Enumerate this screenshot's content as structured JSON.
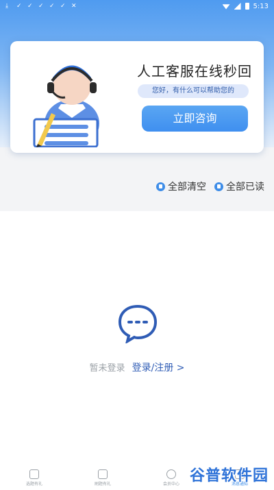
{
  "status_bar": {
    "time": "5:13"
  },
  "service_card": {
    "title": "人工客服在线秒回",
    "subtitle": "您好，有什么可以帮助您的",
    "consult_button": "立即咨询"
  },
  "actions": {
    "clear_all": "全部清空",
    "mark_all_read": "全部已读"
  },
  "empty_state": {
    "not_logged_in": "暂未登录",
    "login_link": "登录/注册 >"
  },
  "tabs": [
    {
      "label": "选题有礼"
    },
    {
      "label": "刷题有礼"
    },
    {
      "label": "会员中心"
    },
    {
      "label": "消息通知"
    }
  ],
  "watermark": "谷普软件园",
  "colors": {
    "accent": "#3e8de8",
    "link": "#2f5cb5",
    "card_button": "#4f9bf0"
  }
}
